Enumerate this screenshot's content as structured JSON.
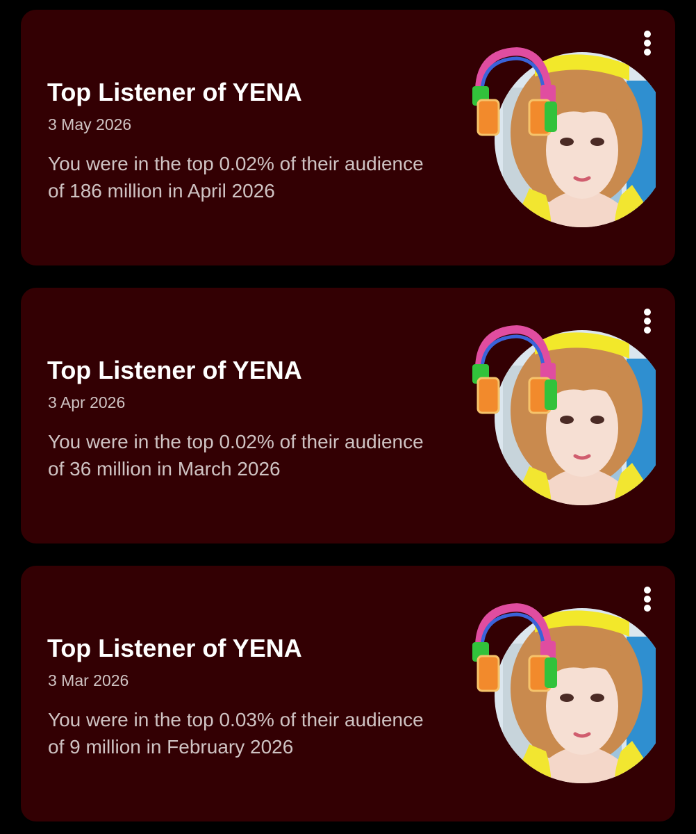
{
  "feed": {
    "cards": [
      {
        "title": "Top Listener of YENA",
        "date": "3 May 2026",
        "message": "You were in the top 0.02% of their audience of 186 million in April 2026",
        "image": "artist-photo-with-headphones"
      },
      {
        "title": "Top Listener of YENA",
        "date": "3 Apr 2026",
        "message": "You were in the top 0.02% of their audience of 36 million in March 2026",
        "image": "artist-photo-with-headphones"
      },
      {
        "title": "Top Listener of YENA",
        "date": "3 Mar 2026",
        "message": "You were in the top 0.03% of their audience of 9 million in February 2026",
        "image": "artist-photo-with-headphones"
      }
    ],
    "more_icon": "more-vertical-icon"
  },
  "colors": {
    "background": "#000000",
    "card": "#330003",
    "title": "#ffffff",
    "secondary_text": "#cfc3c3",
    "headband": "#f2e82a",
    "hair": "#c98a4e"
  }
}
